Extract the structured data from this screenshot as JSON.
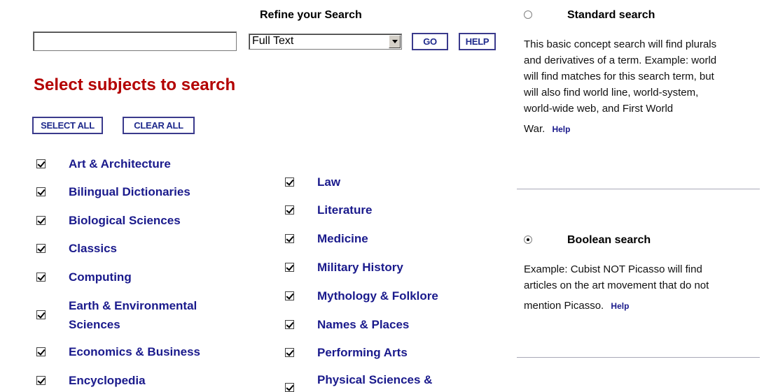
{
  "refine": {
    "heading": "Refine your Search",
    "search_value": "",
    "mode_selected": "Full Text",
    "go_label": "GO",
    "help_label": "HELP"
  },
  "subjects": {
    "title": "Select subjects to search",
    "select_all_label": "SELECT ALL",
    "clear_all_label": "CLEAR ALL",
    "col1": [
      {
        "label": "Art & Architecture",
        "checked": true
      },
      {
        "label": "Bilingual Dictionaries",
        "checked": true
      },
      {
        "label": "Biological Sciences",
        "checked": true
      },
      {
        "label": "Classics",
        "checked": true
      },
      {
        "label": "Computing",
        "checked": true
      },
      {
        "label_line1": "Earth & Environmental",
        "label_line2": "Sciences",
        "checked": true
      },
      {
        "label": "Economics & Business",
        "checked": true
      },
      {
        "label": "Encyclopedia",
        "checked": true
      }
    ],
    "col2": [
      {
        "label": "Law",
        "checked": true
      },
      {
        "label": "Literature",
        "checked": true
      },
      {
        "label": "Medicine",
        "checked": true
      },
      {
        "label": "Military History",
        "checked": true
      },
      {
        "label": "Mythology & Folklore",
        "checked": true
      },
      {
        "label": "Names & Places",
        "checked": true
      },
      {
        "label": "Performing Arts",
        "checked": true
      },
      {
        "label": "Physical Sciences &",
        "checked": true
      }
    ]
  },
  "search_types": {
    "standard": {
      "title": "Standard search",
      "selected": false,
      "lines": [
        "This basic concept search will find plurals",
        "and derivatives of a term. Example: world",
        "will find matches for this search term, but",
        "will also find world line, world-system,",
        "world-wide web, and First World",
        "War."
      ],
      "help_label": "Help"
    },
    "boolean": {
      "title": "Boolean search",
      "selected": true,
      "lines": [
        "Example: Cubist NOT Picasso will find",
        "articles on the art movement that do not",
        "mention Picasso."
      ],
      "help_label": "Help"
    }
  }
}
